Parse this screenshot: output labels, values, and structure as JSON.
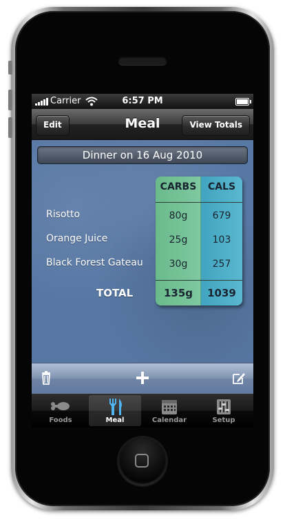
{
  "status_bar": {
    "carrier": "Carrier",
    "time": "6:57 PM"
  },
  "nav": {
    "edit_label": "Edit",
    "title": "Meal",
    "view_totals_label": "View Totals"
  },
  "meal": {
    "date_banner": "Dinner on 16 Aug 2010",
    "headers": {
      "carbs": "CARBS",
      "cals": "CALS"
    },
    "items": [
      {
        "name": "Risotto",
        "carbs": "80g",
        "cals": "679"
      },
      {
        "name": "Orange Juice",
        "carbs": "25g",
        "cals": "103"
      },
      {
        "name": "Black Forest Gateau",
        "carbs": "30g",
        "cals": "257"
      }
    ],
    "total_label": "TOTAL",
    "total_carbs": "135g",
    "total_cals": "1039"
  },
  "toolbar": {
    "icons": [
      "trash-icon",
      "plus-icon",
      "compose-icon"
    ]
  },
  "tabs": [
    {
      "label": "Foods",
      "icon": "chicken-leg-icon"
    },
    {
      "label": "Meal",
      "icon": "fork-knife-icon",
      "active": true
    },
    {
      "label": "Calendar",
      "icon": "calendar-icon"
    },
    {
      "label": "Setup",
      "icon": "sliders-icon"
    }
  ],
  "colors": {
    "carbs_column": "#7fc9a0",
    "cals_column": "#5ab8cf",
    "background": "#5878a4",
    "toolbar": "#7f92b0"
  }
}
